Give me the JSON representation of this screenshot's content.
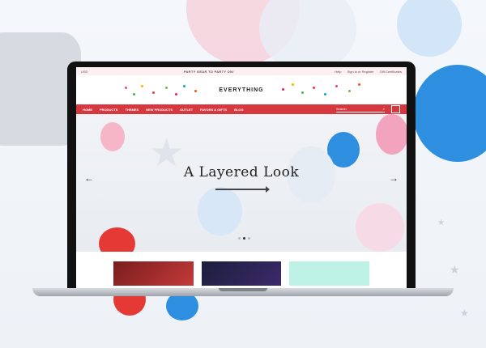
{
  "topbar": {
    "currency": "USD",
    "promo": "PARTY GEAR TO PARTY ON!",
    "links": [
      "Help",
      "Sign in or Register",
      "Gift Certificates"
    ]
  },
  "header": {
    "logo": "EVERYTHING"
  },
  "nav": {
    "items": [
      "HOME",
      "PRODUCTS",
      "THEMES",
      "NEW PRODUCTS",
      "OUTLET",
      "FAVORS & GIFTS",
      "BLOG"
    ],
    "search_placeholder": "Search"
  },
  "hero": {
    "title": "A Layered Look",
    "slides": 3,
    "active_slide": 2
  },
  "colors": {
    "accent": "#d6383f",
    "topbar_bg": "#fdf0f2",
    "tile1": "#c43a3a",
    "tile2": "#1b1e3d",
    "tile3": "#bff2e6"
  }
}
